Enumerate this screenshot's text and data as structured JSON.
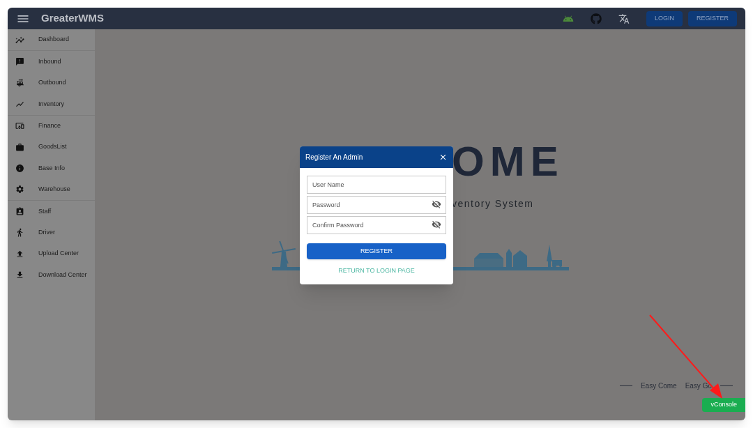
{
  "header": {
    "title": "GreaterWMS",
    "buttons": [
      "LOGIN",
      "REGISTER"
    ]
  },
  "sidebar": {
    "groups": [
      [
        {
          "label": "Dashboard"
        }
      ],
      [
        {
          "label": "Inbound"
        },
        {
          "label": "Outbound"
        },
        {
          "label": "Inventory"
        }
      ],
      [
        {
          "label": "Finance"
        },
        {
          "label": "GoodsList"
        },
        {
          "label": "Base Info"
        },
        {
          "label": "Warehouse"
        }
      ],
      [
        {
          "label": "Staff"
        },
        {
          "label": "Driver"
        },
        {
          "label": "Upload Center"
        },
        {
          "label": "Download Center"
        }
      ]
    ]
  },
  "hero": {
    "title": "OME",
    "subtitle": "ventory System"
  },
  "dialog": {
    "title": "Register An Admin",
    "fields": [
      {
        "placeholder": "User Name",
        "kind": "text"
      },
      {
        "placeholder": "Password",
        "kind": "password"
      },
      {
        "placeholder": "Confirm Password",
        "kind": "password"
      }
    ],
    "submit": "REGISTER",
    "link": "RETURN TO LOGIN PAGE"
  },
  "footer": {
    "left": "Easy Come",
    "right": "Easy Go"
  },
  "console_button": "vConsole"
}
